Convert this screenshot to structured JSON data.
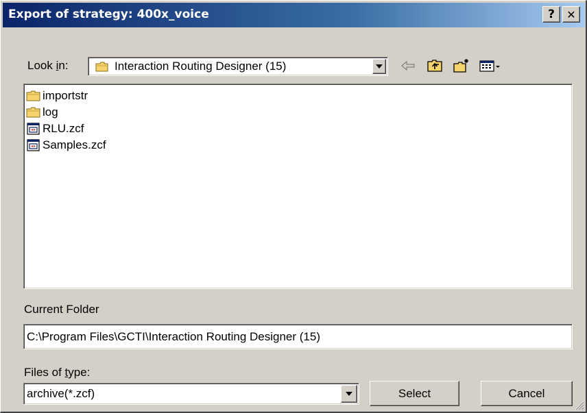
{
  "window": {
    "title": "Export of strategy: 400x_voice",
    "help_label": "?",
    "close_label": "✕"
  },
  "lookin": {
    "label_pre": "Look ",
    "label_accel": "i",
    "label_post": "n:",
    "value": "Interaction Routing Designer (15)"
  },
  "toolbar": {
    "back_icon": "back-arrow-icon",
    "up_icon": "up-one-level-icon",
    "new_folder_icon": "create-new-folder-icon",
    "view_menu_icon": "view-menu-icon"
  },
  "files": [
    {
      "name": "importstr",
      "icon": "folder-icon"
    },
    {
      "name": "log",
      "icon": "folder-icon"
    },
    {
      "name": "RLU.zcf",
      "icon": "document-icon"
    },
    {
      "name": "Samples.zcf",
      "icon": "document-icon"
    }
  ],
  "current_folder": {
    "label": "Current Folder",
    "value": "C:\\Program Files\\GCTI\\Interaction Routing Designer (15)"
  },
  "filetype": {
    "label_pre": "Files of ",
    "label_accel": "t",
    "label_post": "ype:",
    "value": "archive(*.zcf)"
  },
  "buttons": {
    "select": "Select",
    "cancel": "Cancel"
  },
  "colors": {
    "title_start": "#0a246a",
    "title_end": "#a6caf0",
    "face": "#d4d0c8",
    "folder": "#f5d36b"
  }
}
